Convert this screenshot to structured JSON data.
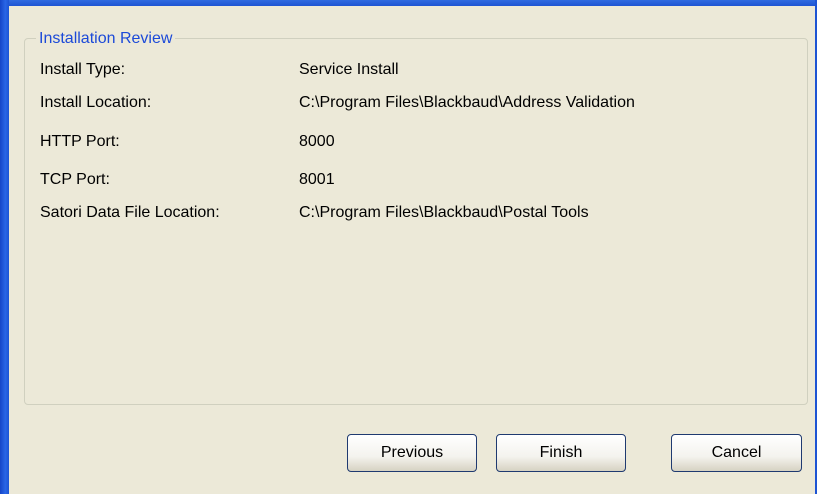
{
  "group": {
    "title": "Installation Review"
  },
  "fields": [
    {
      "label": "Install Type:",
      "value": "Service Install"
    },
    {
      "label": "Install Location:",
      "value": "C:\\Program Files\\Blackbaud\\Address Validation"
    },
    {
      "label": "HTTP Port:",
      "value": "8000"
    },
    {
      "label": "TCP Port:",
      "value": "8001"
    },
    {
      "label": "Satori Data File Location:",
      "value": "C:\\Program Files\\Blackbaud\\Postal Tools"
    }
  ],
  "buttons": {
    "previous": "Previous",
    "finish": "Finish",
    "cancel": "Cancel"
  },
  "colors": {
    "frame": "#1d54d3",
    "dialog_background": "#ece9d8",
    "group_title": "#1c4ad8"
  }
}
